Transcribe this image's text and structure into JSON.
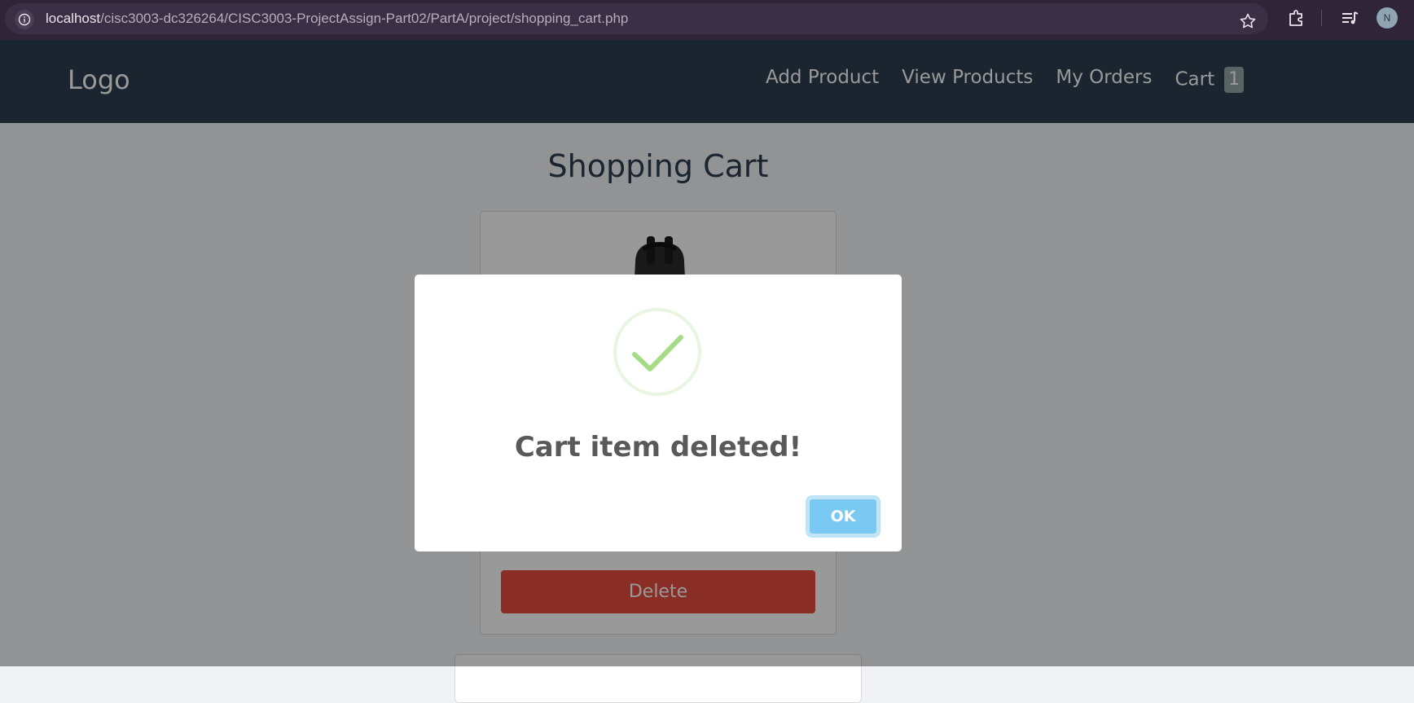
{
  "browser": {
    "url_host": "localhost",
    "url_path": "/cisc3003-dc326264/CISC3003-ProjectAssign-Part02/PartA/project/shopping_cart.php",
    "profile_initial": "N",
    "icons": [
      "site-info-icon",
      "star-icon",
      "extensions-icon",
      "media-icon"
    ]
  },
  "navbar": {
    "logo": "Logo",
    "links": [
      "Add Product",
      "View Products",
      "My Orders",
      "Cart"
    ],
    "cart_count": "1"
  },
  "main": {
    "title": "Shopping Cart",
    "delete_label": "Delete"
  },
  "modal": {
    "title": "Cart item deleted!",
    "ok_label": "OK",
    "icon": "success-check-icon"
  },
  "colors": {
    "navbar": "#2c3e50",
    "delete": "#e74c3c",
    "ok": "#7ac9f3",
    "check": "#a5dc86"
  }
}
